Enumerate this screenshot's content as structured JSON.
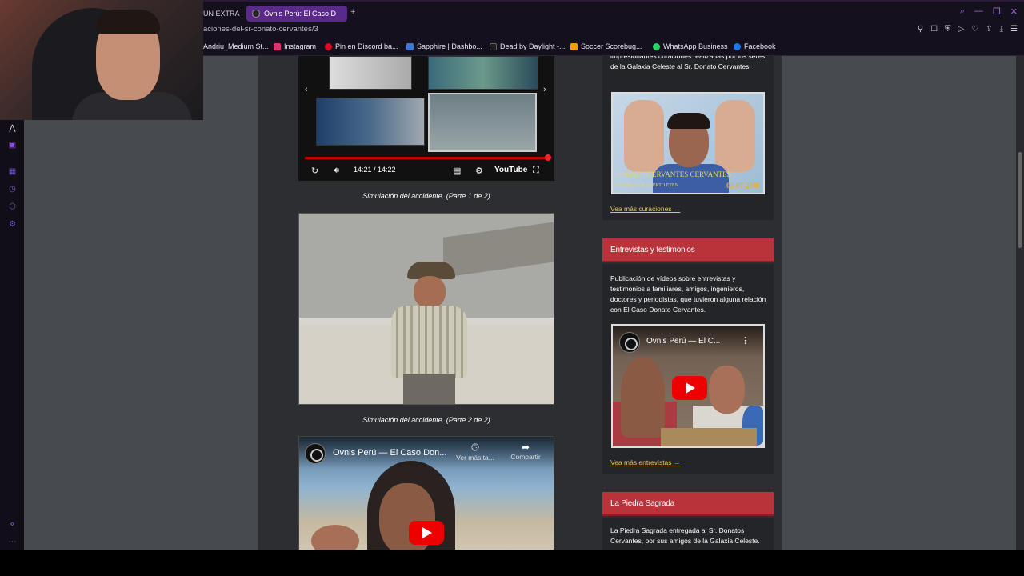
{
  "browser": {
    "tabs": [
      {
        "label": "UN EXTRA",
        "active": false
      },
      {
        "label": "Ovnis Perú: El Caso D",
        "active": true
      }
    ],
    "url": "aciones-del-sr-conato-cervantes/3",
    "bookmarks": [
      {
        "label": "Andriu_Medium St...",
        "color": "#555555"
      },
      {
        "label": "Instagram",
        "color": "#e1306c"
      },
      {
        "label": "Pin en Discord ba...",
        "color": "#e60023"
      },
      {
        "label": "Sapphire | Dashbo...",
        "color": "#3a7bd5"
      },
      {
        "label": "Dead by Daylight -...",
        "color": "#1a1a1a"
      },
      {
        "label": "Soccer Scorebug...",
        "color": "#f0a000"
      },
      {
        "label": "WhatsApp Business",
        "color": "#25d366"
      },
      {
        "label": "Facebook",
        "color": "#1877f2"
      }
    ]
  },
  "gallery_player": {
    "time": "14:21 / 14:22",
    "logo": "YouTube",
    "progress": 0.99
  },
  "main": {
    "caption1": "Simulación del accidente. (Parte 1 de 2)",
    "caption2": "Simulación del accidente. (Parte 2 de 2)",
    "embed3": {
      "title": "Ovnis Perú — El Caso Don...",
      "watch_later": "Ver más ta...",
      "share": "Compartir"
    }
  },
  "sidebar": {
    "healings": {
      "text": "impresionantes curaciones realizadas por los seres de la Galaxia Celeste al Sr. Donato Cervantes.",
      "image_caption": "DONATO CERVANTES CERVANTES",
      "image_sub": "DISTRITO DE PUERTO ETEN",
      "image_date": "02-07-2008",
      "link": "Vea más curaciones →"
    },
    "interviews": {
      "header": "Entrevistas y testimonios",
      "text": "Publicación de vídeos sobre entrevistas y testimonios a familiares, amigos, ingenieros, doctores y periodistas, que tuvieron alguna relación con El Caso Donato Cervantes.",
      "video_title": "Ovnis Perú — El C...",
      "link": "Vea más entrevistas →"
    },
    "stone": {
      "header": "La Piedra Sagrada",
      "text": "La Piedra Sagrada entregada al Sr. Donatos Cervantes, por sus amigos de la Galaxia Celeste."
    }
  },
  "colors": {
    "accent_red": "#b8333a",
    "link_yellow": "#e6c65a",
    "tab_active": "#5a2a8a"
  }
}
